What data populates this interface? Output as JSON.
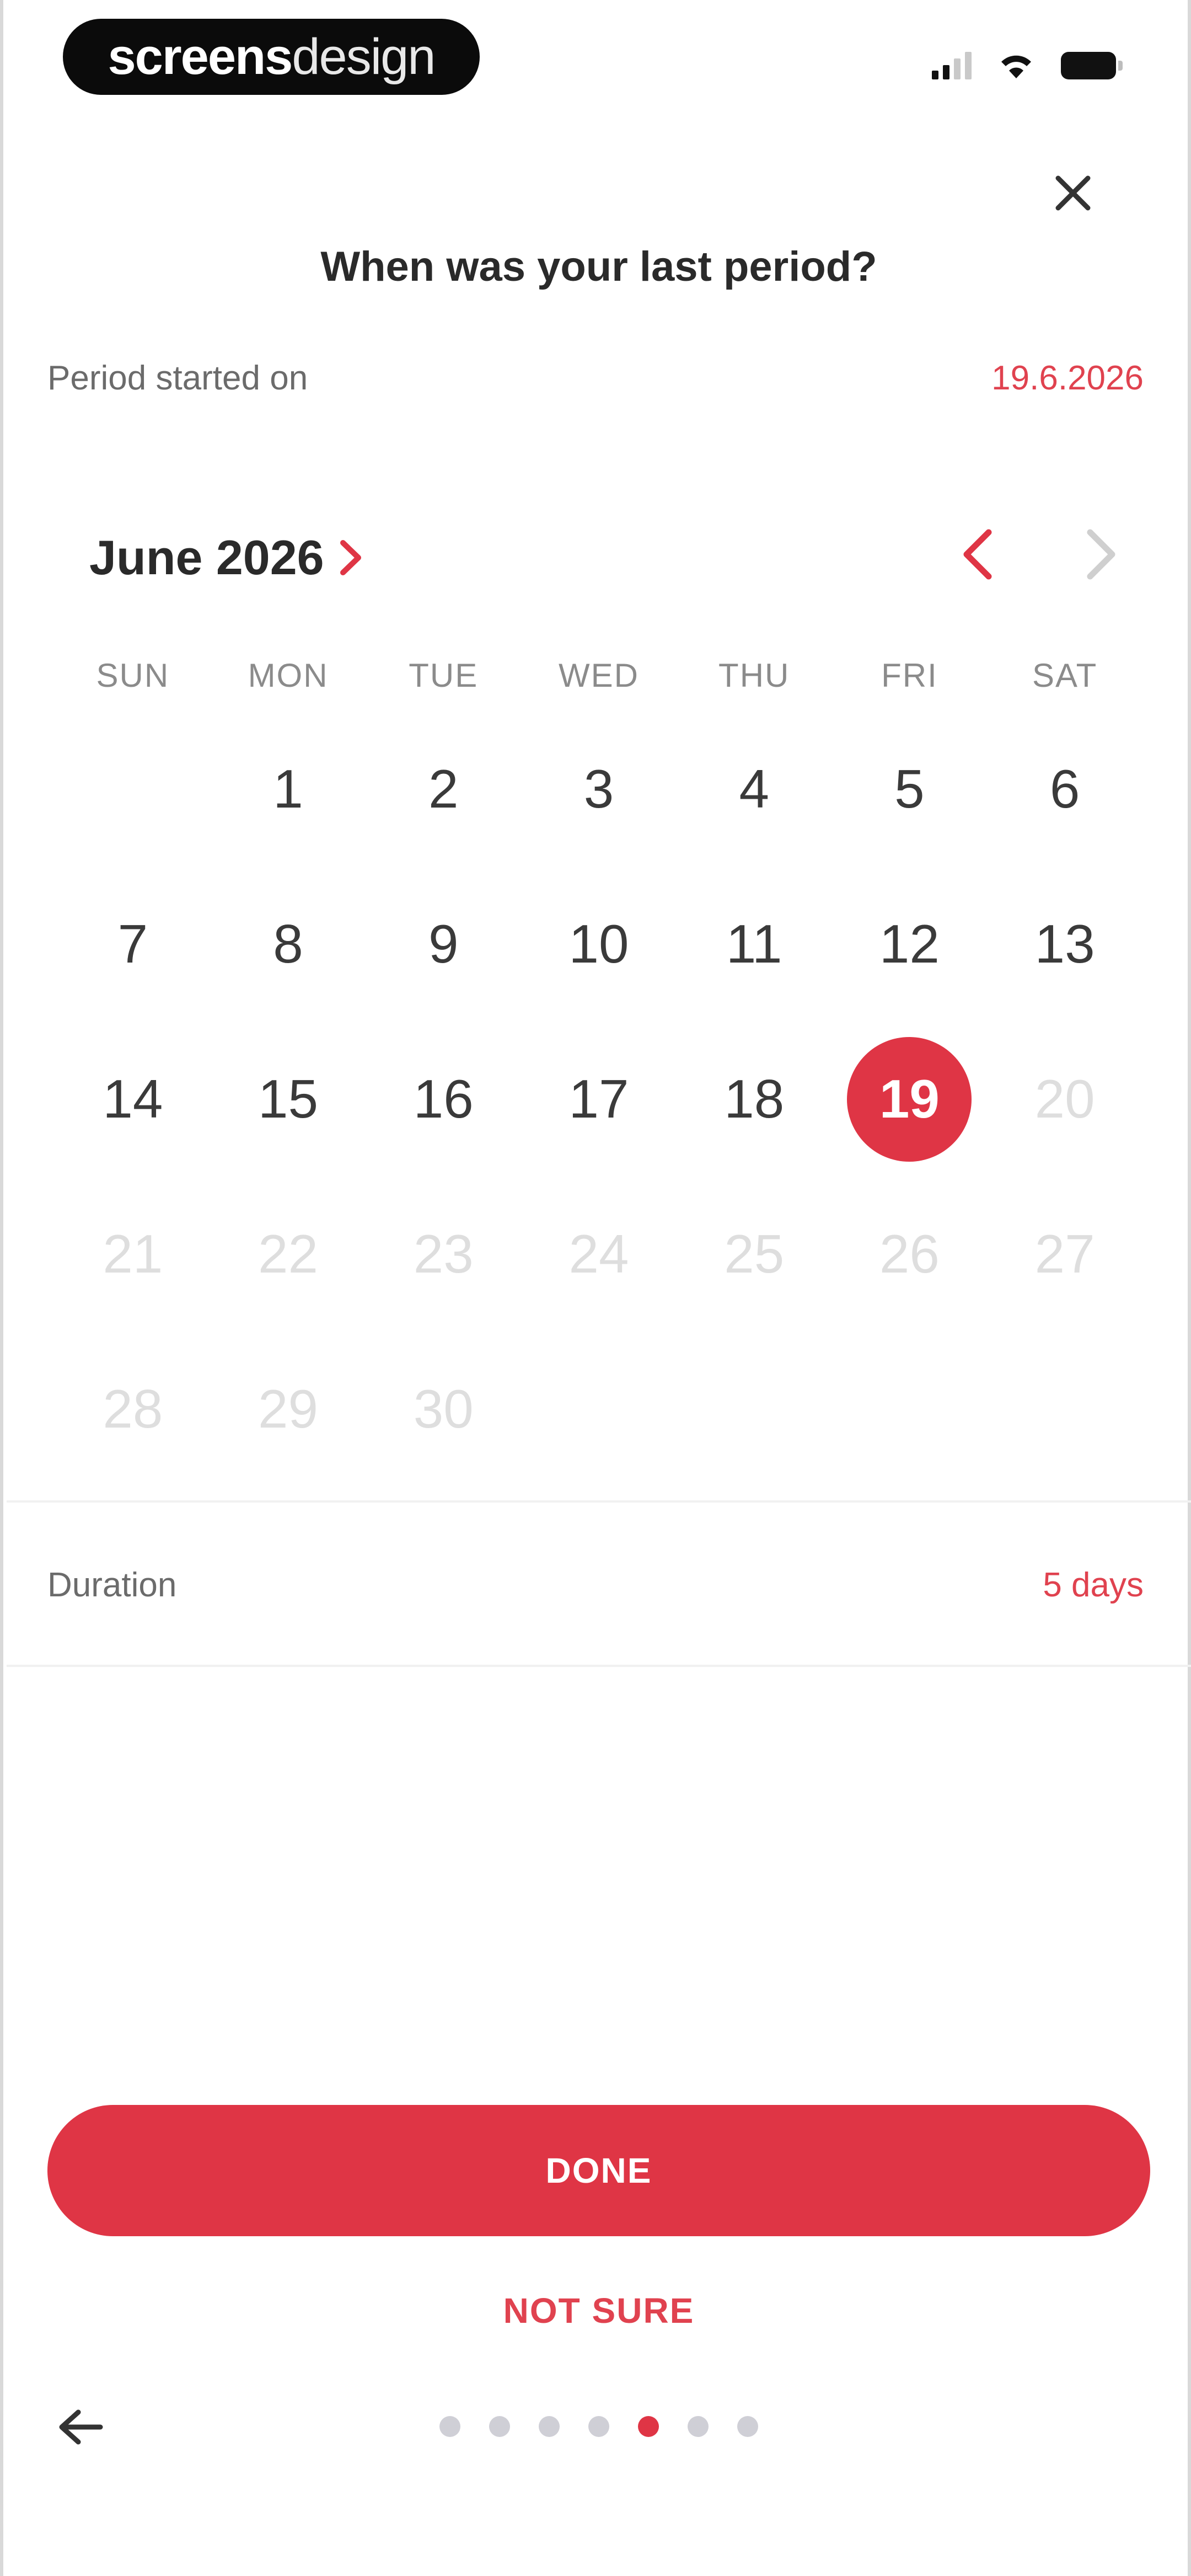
{
  "status_bar": {
    "brand_bold": "screens",
    "brand_light": "design",
    "icons": [
      "signal-icon",
      "wifi-icon",
      "battery-icon"
    ]
  },
  "header": {
    "close_icon": "close-icon",
    "title": "When was your last period?"
  },
  "period_started": {
    "label": "Period started on",
    "value": "19.6.2026"
  },
  "calendar": {
    "month_label": "June 2026",
    "weekdays": [
      "SUN",
      "MON",
      "TUE",
      "WED",
      "THU",
      "FRI",
      "SAT"
    ],
    "leading_empty": 1,
    "days": [
      "1",
      "2",
      "3",
      "4",
      "5",
      "6",
      "7",
      "8",
      "9",
      "10",
      "11",
      "12",
      "13",
      "14",
      "15",
      "16",
      "17",
      "18",
      "19",
      "20",
      "21",
      "22",
      "23",
      "24",
      "25",
      "26",
      "27",
      "28",
      "29",
      "30"
    ],
    "selected_day": "19",
    "last_enabled_day": "19",
    "prev_icon": "chevron-left-icon",
    "next_icon": "chevron-right-icon",
    "month_picker_icon": "chevron-right-icon"
  },
  "duration": {
    "label": "Duration",
    "value": "5 days"
  },
  "actions": {
    "done_label": "DONE",
    "not_sure_label": "NOT SURE",
    "back_icon": "arrow-left-icon"
  },
  "pager": {
    "total": 7,
    "active_index": 4
  },
  "colors": {
    "accent": "#df3545",
    "accent_text": "#e0424f",
    "disabled_day": "#dedede",
    "dot_inactive": "#cfcfd6"
  }
}
